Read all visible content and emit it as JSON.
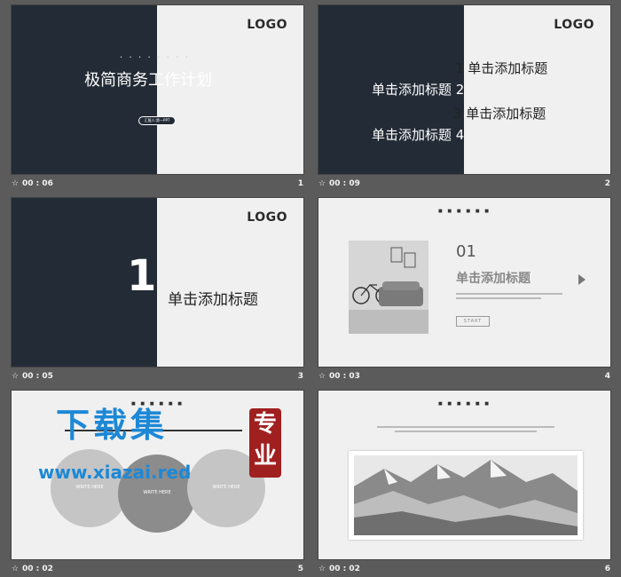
{
  "slides": [
    {
      "num": "1",
      "time": "00 : 06",
      "logo": "LOGO",
      "title": "极简商务工作计划",
      "button": "汇报人:第一PPT"
    },
    {
      "num": "2",
      "time": "00 : 09",
      "logo": "LOGO",
      "toc": [
        "1 单击添加标题",
        "单击添加标题 2",
        "3 单击添加标题",
        "单击添加标题 4"
      ]
    },
    {
      "num": "3",
      "time": "00 : 05",
      "logo": "LOGO",
      "section_number": "1",
      "section_title": "单击添加标题"
    },
    {
      "num": "4",
      "time": "00 : 03",
      "number": "01",
      "title": "单击添加标题",
      "button": "START"
    },
    {
      "num": "5",
      "time": "00 : 02",
      "circles": [
        "WRITE HERE",
        "WRITE HERE",
        "WRITE HERE"
      ],
      "watermark_title": "下载集",
      "watermark_url": "www.xiazai.red",
      "watermark_seal": "专业"
    },
    {
      "num": "6",
      "time": "00 : 02"
    }
  ],
  "anim_icon": "star-icon",
  "colors": {
    "dark_panel": "#232b36",
    "background": "#5b5b5b",
    "slide_bg": "#f0f0f0",
    "watermark_blue": "#1d88d6",
    "seal_red": "#a02020"
  }
}
